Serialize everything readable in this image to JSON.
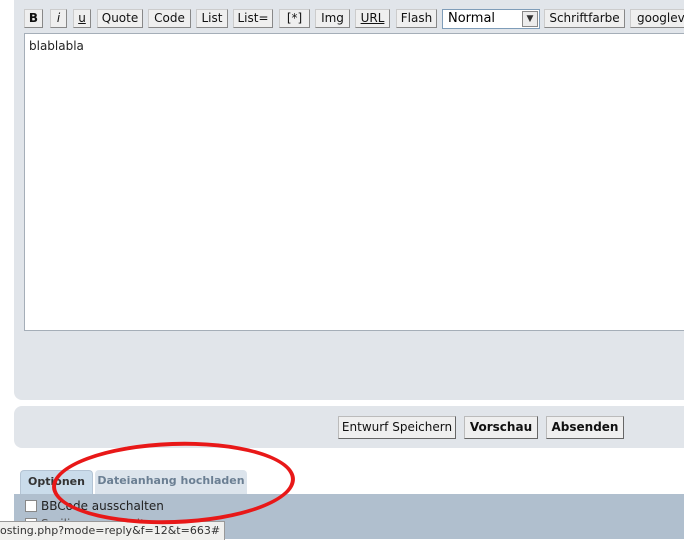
{
  "toolbar": {
    "buttons": [
      "B",
      "i",
      "u",
      "Quote",
      "Code",
      "List",
      "List=",
      "[*]",
      "Img",
      "URL",
      "Flash"
    ],
    "font_size_select": "Normal",
    "color_button": "Schriftfarbe",
    "extra_button": "googlevi"
  },
  "editor": {
    "text": "blablabla"
  },
  "actions": {
    "draft": "Entwurf Speichern",
    "preview": "Vorschau",
    "submit": "Absenden"
  },
  "tabs": {
    "options": "Optionen",
    "attachment": "Dateianhang hochladen"
  },
  "options": {
    "bbcode": "BBCode ausschalten",
    "smilies": "Smilies ausschalten"
  },
  "status_bar": {
    "url": "osting.php?mode=reply&f=12&t=663#"
  },
  "annotation": {
    "color": "#e81818"
  }
}
